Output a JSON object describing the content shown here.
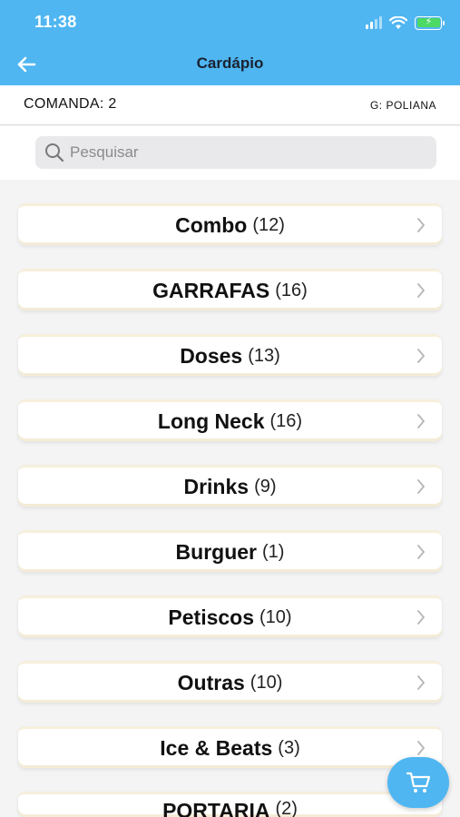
{
  "status_bar": {
    "time": "11:38"
  },
  "header": {
    "title": "Cardápio",
    "back_icon": "arrow-left-icon"
  },
  "comanda": {
    "label": "COMANDA: 2",
    "garcom": "G: POLIANA"
  },
  "search": {
    "placeholder": "Pesquisar",
    "value": ""
  },
  "categories": [
    {
      "name": "Combo",
      "count": "(12)"
    },
    {
      "name": "GARRAFAS",
      "count": "(16)"
    },
    {
      "name": "Doses",
      "count": "(13)"
    },
    {
      "name": "Long Neck",
      "count": "(16)"
    },
    {
      "name": "Drinks",
      "count": "(9)"
    },
    {
      "name": "Burguer",
      "count": "(1)"
    },
    {
      "name": "Petiscos",
      "count": "(10)"
    },
    {
      "name": "Outras",
      "count": "(10)"
    },
    {
      "name": "Ice & Beats",
      "count": "(3)"
    },
    {
      "name": "PORTARIA",
      "count": "(2)"
    }
  ],
  "colors": {
    "primary": "#4fb6f1",
    "background": "#f4f4f5"
  },
  "cart_button": {
    "icon": "cart-icon"
  }
}
